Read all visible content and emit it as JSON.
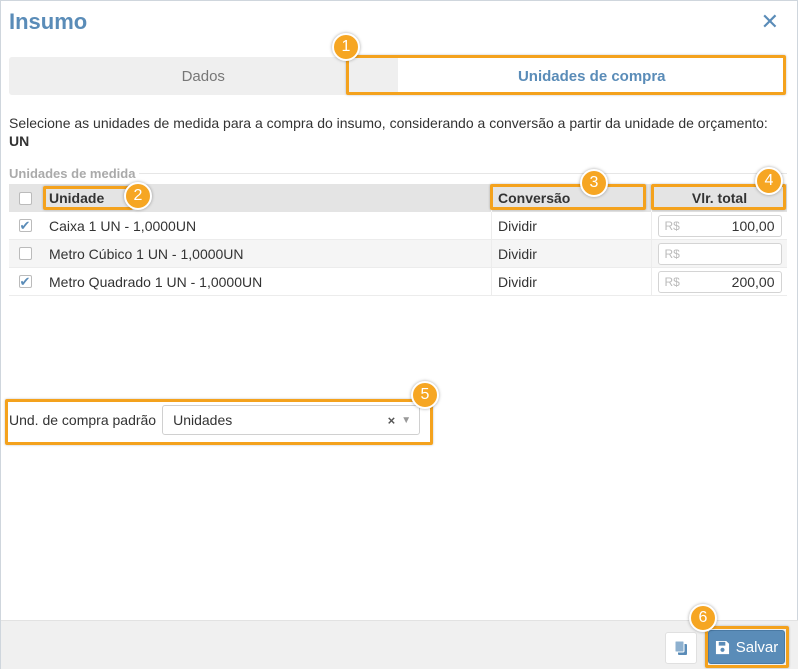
{
  "dialog": {
    "title": "Insumo",
    "close_glyph": "✕"
  },
  "tabs": [
    {
      "label": "Dados",
      "active": false
    },
    {
      "label": "Unidades de compra",
      "active": true
    }
  ],
  "description": {
    "text": "Selecione as unidades de medida para a compra do insumo, considerando a conversão a partir da unidade de orçamento: ",
    "unit": "UN"
  },
  "section": {
    "legend": "Unidades de medida"
  },
  "grid": {
    "headers": {
      "unit": "Unidade",
      "conversion": "Conversão",
      "total": "Vlr. total"
    },
    "currency_symbol": "R$",
    "rows": [
      {
        "checked": true,
        "unit": "Caixa 1 UN - 1,0000UN",
        "conversion": "Dividir",
        "total": "100,00"
      },
      {
        "checked": false,
        "unit": "Metro Cúbico 1 UN - 1,0000UN",
        "conversion": "Dividir",
        "total": ""
      },
      {
        "checked": true,
        "unit": "Metro Quadrado 1 UN - 1,0000UN",
        "conversion": "Dividir",
        "total": "200,00"
      }
    ]
  },
  "default_unit": {
    "label": "Und. de compra padrão",
    "value": "Unidades",
    "clear_glyph": "×",
    "caret_glyph": "▼"
  },
  "footer": {
    "save_label": "Salvar"
  },
  "callouts": [
    "1",
    "2",
    "3",
    "4",
    "5",
    "6"
  ],
  "colors": {
    "accent": "#5a8cb8",
    "highlight": "#f4a21d"
  }
}
